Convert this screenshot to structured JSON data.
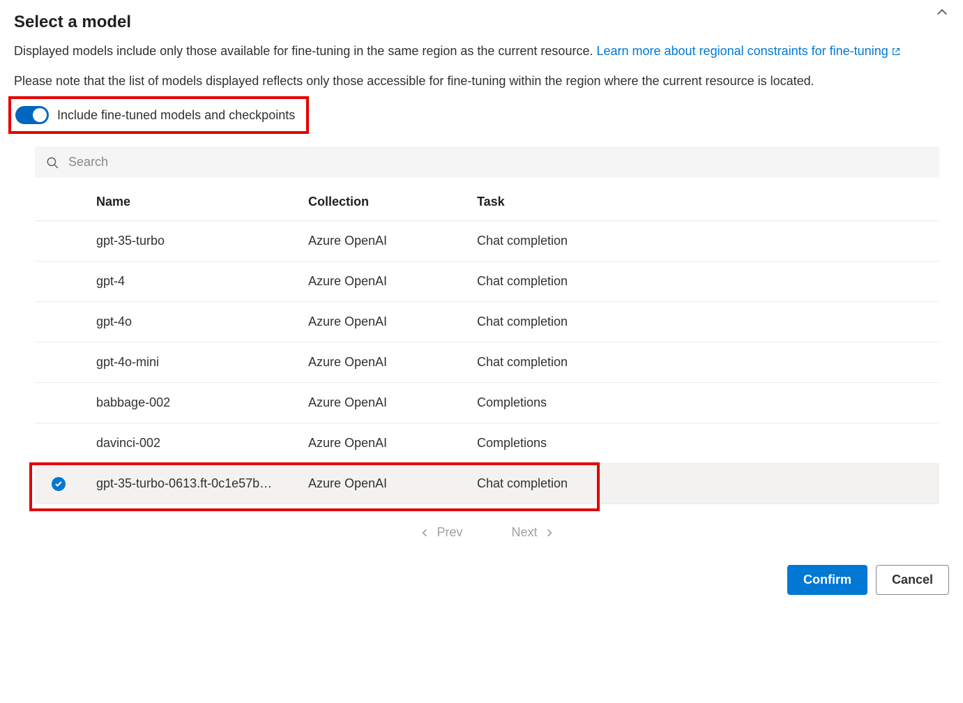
{
  "header": {
    "title": "Select a model",
    "description_prefix": "Displayed models include only those available for fine-tuning in the same region as the current resource. ",
    "learn_more_link": "Learn more about regional constraints for fine-tuning",
    "note": "Please note that the list of models displayed reflects only those accessible for fine-tuning within the region where the current resource is located."
  },
  "toggle": {
    "label": "Include fine-tuned models and checkpoints",
    "state": true
  },
  "search": {
    "placeholder": "Search",
    "value": ""
  },
  "table": {
    "columns": {
      "name": "Name",
      "collection": "Collection",
      "task": "Task"
    },
    "rows": [
      {
        "name": "gpt-35-turbo",
        "collection": "Azure OpenAI",
        "task": "Chat completion",
        "selected": false
      },
      {
        "name": "gpt-4",
        "collection": "Azure OpenAI",
        "task": "Chat completion",
        "selected": false
      },
      {
        "name": "gpt-4o",
        "collection": "Azure OpenAI",
        "task": "Chat completion",
        "selected": false
      },
      {
        "name": "gpt-4o-mini",
        "collection": "Azure OpenAI",
        "task": "Chat completion",
        "selected": false
      },
      {
        "name": "babbage-002",
        "collection": "Azure OpenAI",
        "task": "Completions",
        "selected": false
      },
      {
        "name": "davinci-002",
        "collection": "Azure OpenAI",
        "task": "Completions",
        "selected": false
      },
      {
        "name": "gpt-35-turbo-0613.ft-0c1e57b…",
        "collection": "Azure OpenAI",
        "task": "Chat completion",
        "selected": true
      }
    ]
  },
  "pagination": {
    "prev": "Prev",
    "next": "Next"
  },
  "footer": {
    "confirm": "Confirm",
    "cancel": "Cancel"
  }
}
